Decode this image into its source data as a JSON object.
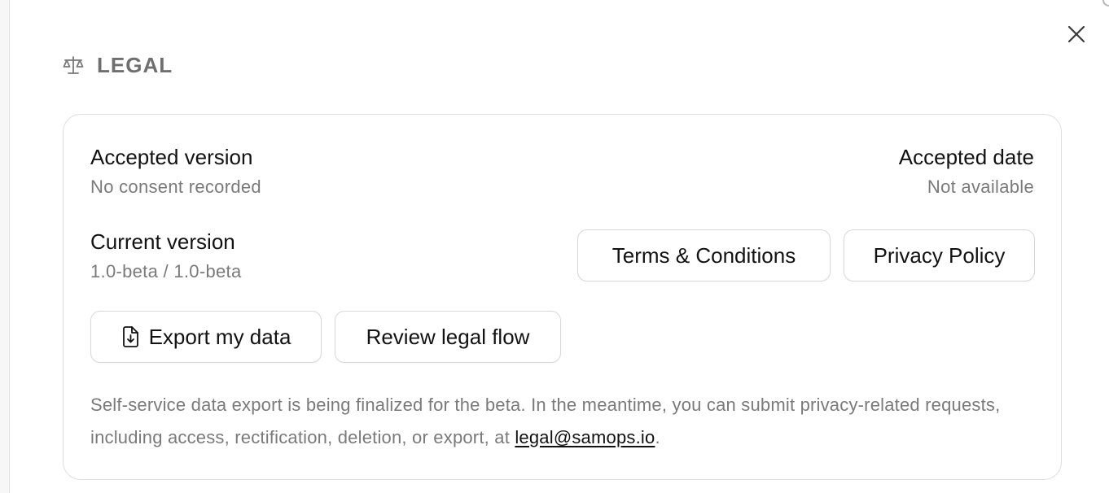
{
  "section": {
    "title": "LEGAL",
    "icon": "scale-icon"
  },
  "close": {
    "icon": "close-icon"
  },
  "consent": {
    "accepted_version_label": "Accepted version",
    "accepted_version_value": "No consent recorded",
    "accepted_date_label": "Accepted date",
    "accepted_date_value": "Not available",
    "current_version_label": "Current version",
    "current_version_value": "1.0-beta / 1.0-beta"
  },
  "links": {
    "terms_label": "Terms & Conditions",
    "privacy_label": "Privacy Policy"
  },
  "actions": {
    "export_label": "Export my data",
    "export_icon": "file-download-icon",
    "review_label": "Review legal flow"
  },
  "note": {
    "text_before": "Self-service data export is being finalized for the beta. In the meantime, you can submit privacy-related requests, including access, rectification, deletion, or export, at ",
    "email": "legal@samops.io",
    "text_after": "."
  },
  "colors": {
    "text_primary": "#121212",
    "text_muted": "#7a7a7a",
    "border": "#dedede",
    "background": "#ffffff"
  }
}
